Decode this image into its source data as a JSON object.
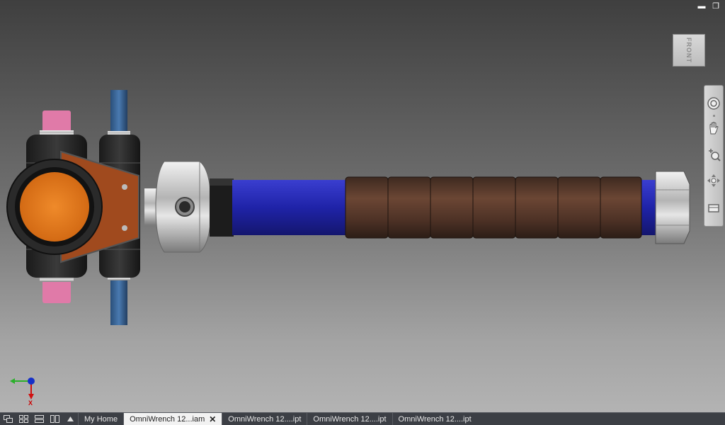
{
  "window": {
    "minimize_glyph": "▬",
    "restore_glyph": "❐"
  },
  "viewcube": {
    "face_label": "FRONT"
  },
  "navbar": {
    "tools": [
      "full-navigation-wheel-icon",
      "pan-icon",
      "zoom-icon",
      "orbit-icon",
      "look-at-icon"
    ]
  },
  "triad": {
    "x_label": "X"
  },
  "tabbar": {
    "tabs": [
      {
        "label": "My Home",
        "active": false
      },
      {
        "label": "OmniWrench 12...iam",
        "active": true,
        "close": "✕"
      },
      {
        "label": "OmniWrench 12....ipt",
        "active": false
      },
      {
        "label": "OmniWrench 12....ipt",
        "active": false
      },
      {
        "label": "OmniWrench 12....ipt",
        "active": false
      }
    ]
  },
  "colors": {
    "handle_blue": "#1f23a8",
    "grip_brown": "#5a3a2a",
    "disc_orange": "#e0771c",
    "brace_orange": "#a04a1e",
    "pin_pink": "#e07aa8",
    "rod_blue": "#3a6aa0"
  }
}
